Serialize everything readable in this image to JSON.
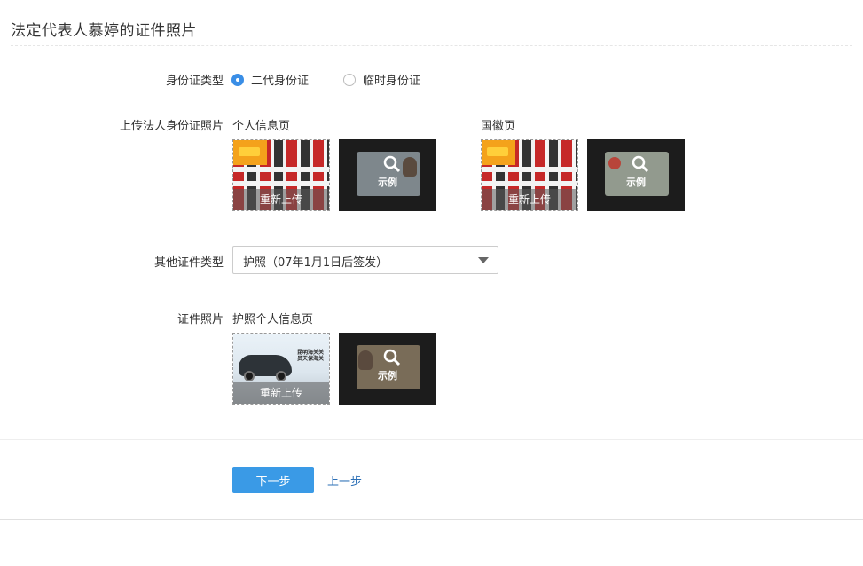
{
  "page": {
    "title": "法定代表人慕婷的证件照片"
  },
  "id_type": {
    "label": "身份证类型",
    "options": [
      {
        "label": "二代身份证",
        "checked": true
      },
      {
        "label": "临时身份证",
        "checked": false
      }
    ]
  },
  "upload_id": {
    "label": "上传法人身份证照片",
    "front": {
      "title": "个人信息页",
      "reupload": "重新上传",
      "sample": "示例"
    },
    "back": {
      "title": "国徽页",
      "reupload": "重新上传",
      "sample": "示例"
    }
  },
  "other_type": {
    "label": "其他证件类型",
    "selected": "护照（07年1月1日后签发）"
  },
  "cert_photo": {
    "label": "证件照片",
    "title": "护照个人信息页",
    "reupload": "重新上传",
    "sample": "示例",
    "image_text": "昆明海关关员天保海关"
  },
  "actions": {
    "next": "下一步",
    "prev": "上一步"
  },
  "colors": {
    "primary": "#3a9ae6",
    "link": "#2b6fb6",
    "radio_checked": "#3a8ee6"
  }
}
